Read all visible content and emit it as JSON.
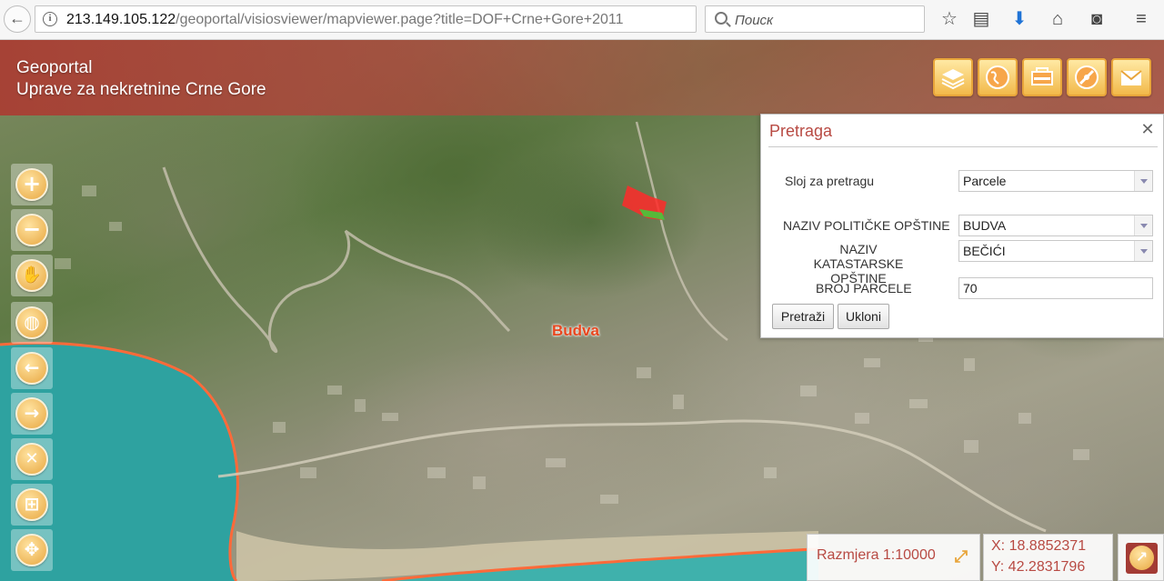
{
  "browser": {
    "url_host": "213.149.105.122",
    "url_path": "/geoportal/visiosviewer/mapviewer.page?title=DOF+Crne+Gore+2011",
    "search_placeholder": "Поиск"
  },
  "header": {
    "brand_line1": "Geoportal",
    "brand_line2": "Uprave za nekretnine Crne Gore",
    "tools": [
      "layers-icon",
      "globe-icon",
      "legend-icon",
      "compass-globe-icon",
      "mail-icon"
    ]
  },
  "left_toolbar": [
    {
      "name": "zoom-in",
      "icon": "plus-icon",
      "glyph": "+"
    },
    {
      "name": "zoom-out",
      "icon": "minus-icon",
      "glyph": "−"
    },
    {
      "name": "pan",
      "icon": "hand-icon",
      "glyph": "✋"
    },
    {
      "name": "full-extent",
      "icon": "globe-icon",
      "glyph": "◍"
    },
    {
      "name": "previous-extent",
      "icon": "arrow-left-icon",
      "glyph": "←"
    },
    {
      "name": "next-extent",
      "icon": "arrow-right-icon",
      "glyph": "→"
    },
    {
      "name": "clear",
      "icon": "close-icon",
      "glyph": "✕"
    },
    {
      "name": "measure",
      "icon": "measure-icon",
      "glyph": "⊞"
    },
    {
      "name": "navigate",
      "icon": "move-icon",
      "glyph": "✥"
    }
  ],
  "map": {
    "place_label": "Budva"
  },
  "search_panel": {
    "title": "Pretraga",
    "layer_label": "Sloj za pretragu",
    "layer_value": "Parcele",
    "municipality_label": "NAZIV POLITIČKE OPŠTINE",
    "municipality_value": "BUDVA",
    "cadastral_label_line1": "NAZIV KATASTARSKE",
    "cadastral_label_line2": "OPŠTINE",
    "cadastral_value": "BEČIĆI",
    "parcel_label": "BROJ PARCELE",
    "parcel_value": "70",
    "search_button": "Pretraži",
    "clear_button": "Ukloni"
  },
  "status": {
    "scale": "Razmjera 1:10000",
    "x": "X: 18.8852371",
    "y": "Y: 42.2831796"
  },
  "colors": {
    "brand": "#b84a43",
    "tool_gold": "#e8a53a",
    "sea": "#2fa6a2",
    "coastline": "#ff6a3a",
    "parcel_highlight": "#ff2a2a"
  }
}
